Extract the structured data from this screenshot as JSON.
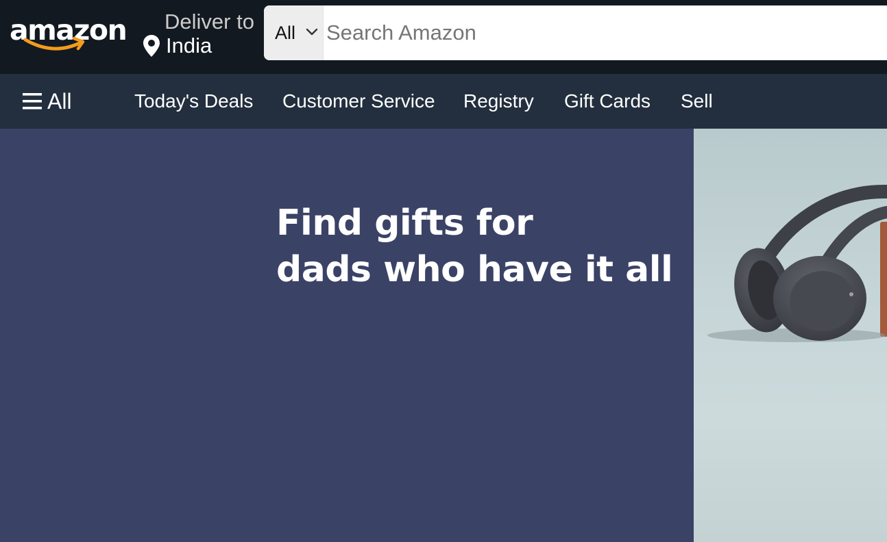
{
  "header": {
    "logo_text": "amazon",
    "deliver_to_label": "Deliver to",
    "deliver_to_location": "India",
    "search": {
      "category": "All",
      "placeholder": "Search Amazon"
    }
  },
  "nav": {
    "all_label": "All",
    "links": [
      "Today's Deals",
      "Customer Service",
      "Registry",
      "Gift Cards",
      "Sell"
    ]
  },
  "hero": {
    "headline_line1": "Find gifts for",
    "headline_line2": "dads who have it all",
    "image_icon": "headphones-image"
  },
  "colors": {
    "header_bg": "#131921",
    "nav_bg": "#232f3e",
    "hero_bg": "#3a4266",
    "logo_smile": "#f39c1c",
    "search_category_bg": "#ededed"
  }
}
